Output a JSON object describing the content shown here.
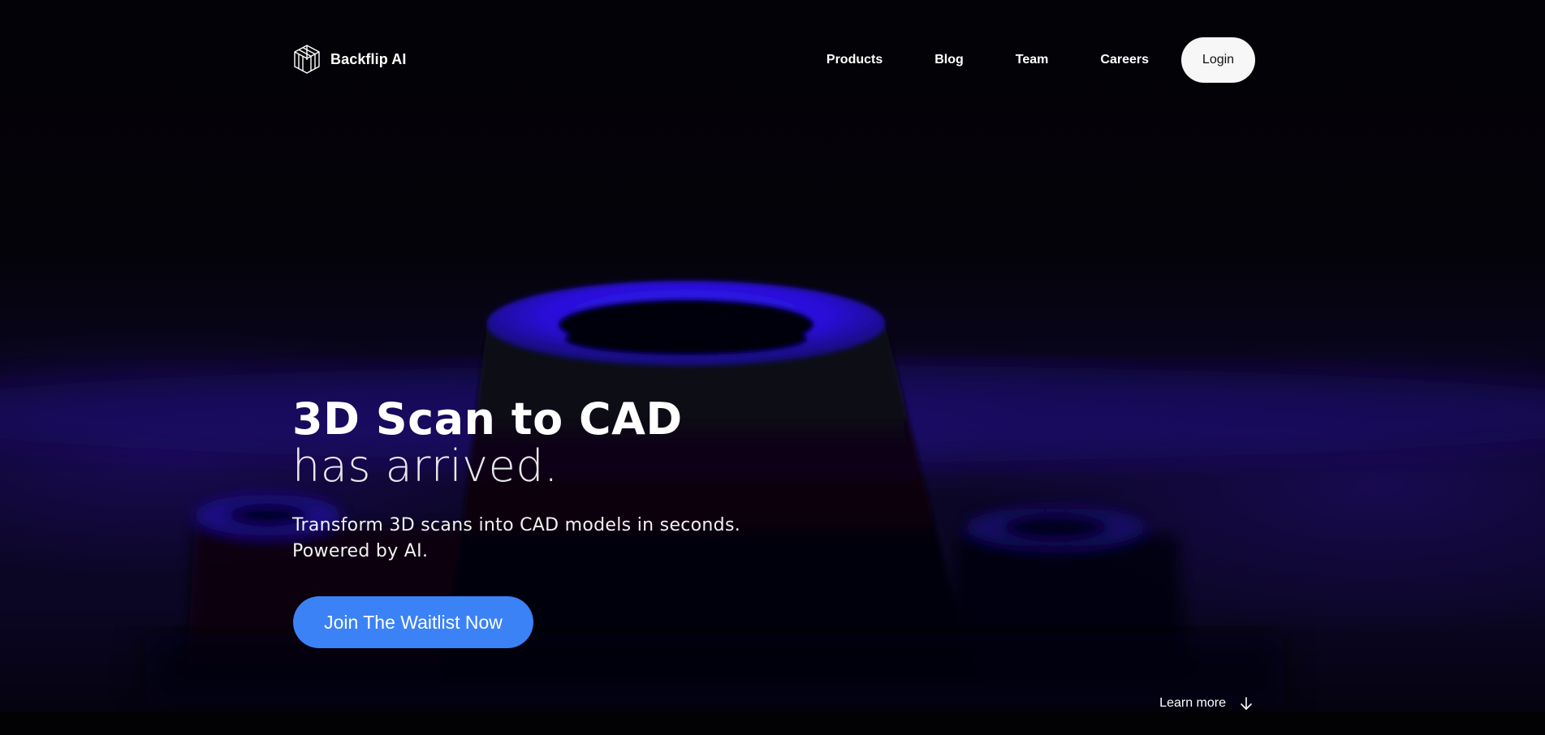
{
  "brand": {
    "name": "Backflip AI",
    "logo_icon": "isometric-cube-logo-icon"
  },
  "nav": {
    "items": [
      {
        "label": "Products"
      },
      {
        "label": "Blog"
      },
      {
        "label": "Team"
      },
      {
        "label": "Careers"
      }
    ],
    "login_label": "Login"
  },
  "hero": {
    "headline_line1": "3D Scan to CAD",
    "headline_line2": "has arrived.",
    "subtitle_line1": "Transform 3D scans into CAD models in seconds.",
    "subtitle_line2": "Powered by AI.",
    "cta_label": "Join The Waitlist Now",
    "learn_more_label": "Learn more",
    "learn_more_icon": "arrow-down-icon"
  },
  "colors": {
    "background": "#030206",
    "accent_glow": "#2a10d0",
    "cta": "#3b82f6",
    "login_bg": "#f7f7f8"
  }
}
